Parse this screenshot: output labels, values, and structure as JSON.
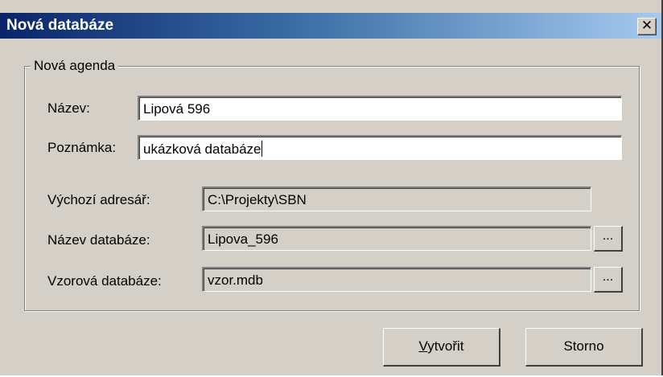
{
  "window": {
    "title": "Nová databáze",
    "close_glyph": "✕"
  },
  "group": {
    "legend": "Nová agenda"
  },
  "fields": {
    "nazev": {
      "label": "Název:",
      "value": "Lipová 596"
    },
    "poznamka": {
      "label": "Poznámka:",
      "value": "ukázková databáze"
    },
    "vychozi_adresar": {
      "label": "Výchozí adresář:",
      "value": "C:\\Projekty\\SBN"
    },
    "nazev_databaze": {
      "label": "Název databáze:",
      "value": "Lipova_596"
    },
    "vzorova_databaze": {
      "label": "Vzorová databáze:",
      "value": "vzor.mdb"
    }
  },
  "browse_label": "...",
  "buttons": {
    "create_first": "V",
    "create_rest": "ytvořit",
    "cancel": "Storno"
  }
}
